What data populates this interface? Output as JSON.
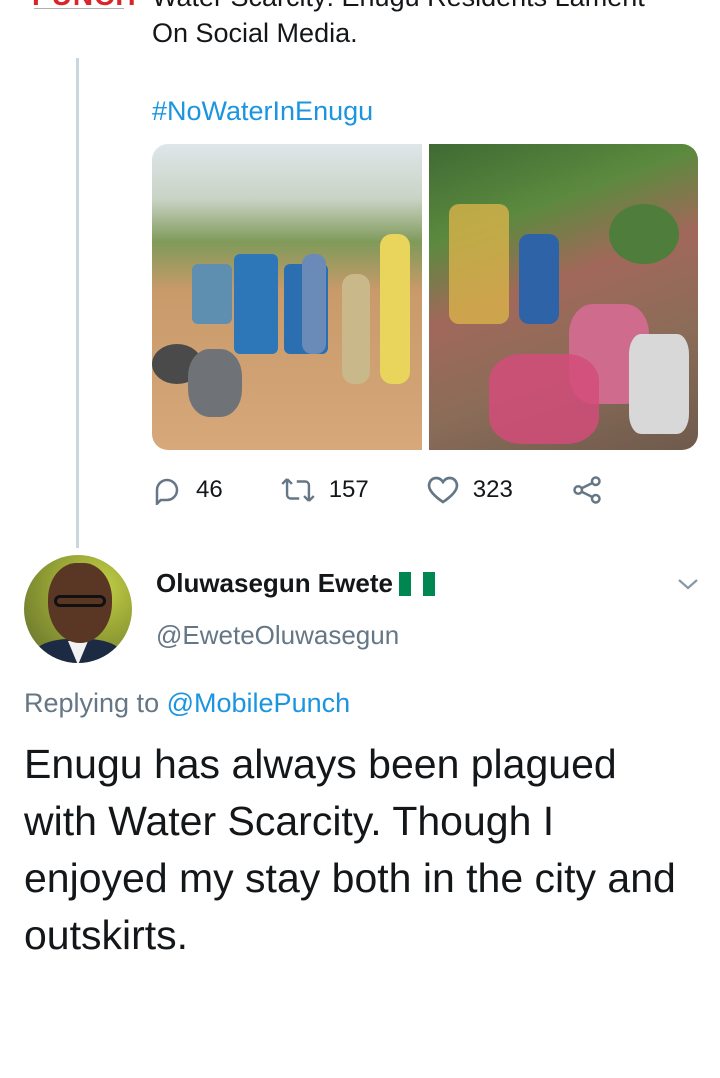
{
  "parent_tweet": {
    "author_logo_text": "PUNCH",
    "text_line_1_partial": "Water Scarcity: Enugu Residents Lament",
    "text_line_2": "On Social Media.",
    "hashtag": "#NoWaterInEnugu",
    "media": [
      {
        "icon": "photo-people-with-water-drums"
      },
      {
        "icon": "photo-crowd-with-jerrycans"
      }
    ],
    "actions": {
      "reply_count": "46",
      "retweet_count": "157",
      "like_count": "323"
    }
  },
  "reply_tweet": {
    "display_name": "Oluwasegun Ewete",
    "handle": "@EweteOluwasegun",
    "replying_prefix": "Replying to",
    "replying_to": "@MobilePunch",
    "text": "Enugu has always been plagued with Water Scarcity. Though I enjoyed my stay both in the city and outskirts."
  },
  "colors": {
    "link": "#1b95e0",
    "muted": "#657786",
    "text": "#14171a",
    "thread_line": "#ccd6dd",
    "punch_red": "#d9252a"
  }
}
